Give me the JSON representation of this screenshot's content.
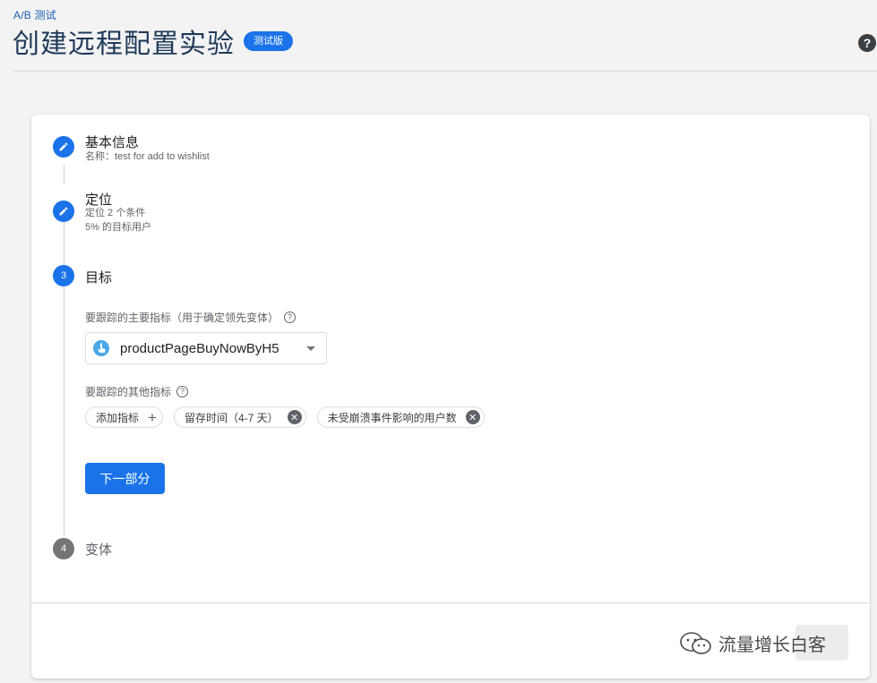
{
  "header": {
    "breadcrumb": "A/B 测试",
    "title": "创建远程配置实验",
    "beta_badge": "测试版",
    "help_icon": "help-circle-icon"
  },
  "steps": [
    {
      "status": "done",
      "title": "基本信息",
      "subtitle_lines": [
        "名称：test for add to wishlist"
      ]
    },
    {
      "status": "done",
      "title": "定位",
      "subtitle_lines": [
        "定位 2 个条件",
        "5% 的目标用户"
      ]
    },
    {
      "status": "active",
      "number": "3",
      "title": "目标"
    },
    {
      "status": "todo",
      "number": "4",
      "title": "变体"
    }
  ],
  "goals": {
    "primary_label": "要跟踪的主要指标（用于确定领先变体）",
    "primary_value": "productPageBuyNowByH5",
    "other_label": "要跟踪的其他指标",
    "add_chip": "添加指标",
    "chips": [
      "留存时间（4-7 天）",
      "未受崩溃事件影响的用户数"
    ],
    "next_button": "下一部分"
  },
  "watermark": {
    "text": "流量增长白客"
  },
  "colors": {
    "accent": "#1a73e8",
    "todo": "#757575"
  }
}
